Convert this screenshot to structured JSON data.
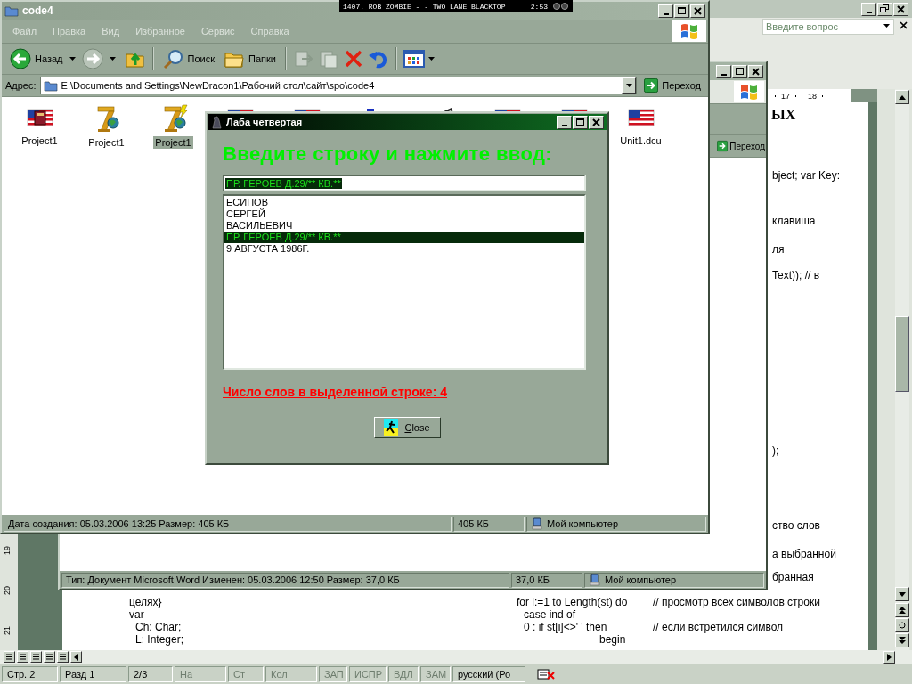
{
  "word": {
    "help_placeholder": "Введите вопрос",
    "ruler_marks": [
      "17",
      "18"
    ],
    "side_ruler_marks": [
      "19",
      "20",
      "21"
    ],
    "page_heading": "ЫХ",
    "page_fragments": [
      "bject; var Key:",
      "клавиша",
      "ля",
      "Text)); // в",
      ");",
      "ство слов",
      "а выбранной",
      "бранная"
    ],
    "code_left": [
      "целях}",
      "var",
      "Ch: Char;",
      "L: Integer;"
    ],
    "code_right": [
      {
        "code": "for i:=1 to Length(st) do",
        "comment": "// просмотр всех символов строки"
      },
      {
        "code": "case ind of"
      },
      {
        "code": "0 : if st[i]<>' ' then",
        "comment": "// если встретился символ"
      },
      {
        "code": "begin"
      }
    ],
    "status": [
      {
        "text": "Стр. 2",
        "disabled": false
      },
      {
        "text": "Разд 1",
        "disabled": false
      },
      {
        "text": "2/3",
        "disabled": false
      },
      {
        "text": "На",
        "disabled": true
      },
      {
        "text": "Ст",
        "disabled": true
      },
      {
        "text": "Кол",
        "disabled": true
      },
      {
        "text": "ЗАП",
        "disabled": true
      },
      {
        "text": "ИСПР",
        "disabled": true
      },
      {
        "text": "ВДЛ",
        "disabled": true
      },
      {
        "text": "ЗАМ",
        "disabled": true
      },
      {
        "text": "русский (Ро",
        "disabled": false
      }
    ]
  },
  "back_window": {
    "go_button": "Переход",
    "status": [
      "Тип: Документ Microsoft Word Изменен: 05.03.2006 12:50 Размер: 37,0 КБ",
      "37,0 КБ",
      "Мой компьютер"
    ]
  },
  "explorer": {
    "title": "code4",
    "menu": [
      "Файл",
      "Правка",
      "Вид",
      "Избранное",
      "Сервис",
      "Справка"
    ],
    "back_button": "Назад",
    "search_button": "Поиск",
    "folders_button": "Папки",
    "address_label": "Адрес:",
    "address": "E:\\Documents and Settings\\NewDracon1\\Рабочий стол\\сайт\\spo\\code4",
    "go_button": "Переход",
    "files": [
      {
        "kind": "flag-book",
        "label": "Project1",
        "selected": false
      },
      {
        "kind": "column-globe",
        "label": "Project1",
        "selected": false
      },
      {
        "kind": "column-bolt",
        "label": "Project1",
        "selected": true
      },
      {
        "kind": "flag"
      },
      {
        "kind": "flag"
      },
      {
        "kind": "buildings"
      },
      {
        "kind": "film"
      },
      {
        "kind": "flag"
      },
      {
        "kind": "flag"
      },
      {
        "kind": "flag",
        "label": "Unit1.dcu",
        "selected": false
      }
    ],
    "status": [
      "Дата создания: 05.03.2006 13:25 Размер: 405 КБ",
      "405 КБ",
      "Мой компьютер"
    ]
  },
  "media_player": {
    "track": "1407. ROB ZOMBIE - - TWO LANE BLACKTOP",
    "time": "2:53"
  },
  "dialog": {
    "title": "Лаба четвертая",
    "prompt": "Введите строку и нажмите ввод:",
    "input": "ПР. ГЕРОЕВ Д.29/** КВ.**",
    "items": [
      {
        "text": "ЕСИПОВ",
        "selected": false
      },
      {
        "text": "СЕРГЕЙ",
        "selected": false
      },
      {
        "text": "ВАСИЛЬЕВИЧ",
        "selected": false
      },
      {
        "text": "ПР. ГЕРОЕВ Д.29/** КВ.**",
        "selected": true
      },
      {
        "text": "9 АВГУСТА 1986Г.",
        "selected": false
      }
    ],
    "result": "Число слов в выделенной строке: 4",
    "close_button": "Close"
  }
}
